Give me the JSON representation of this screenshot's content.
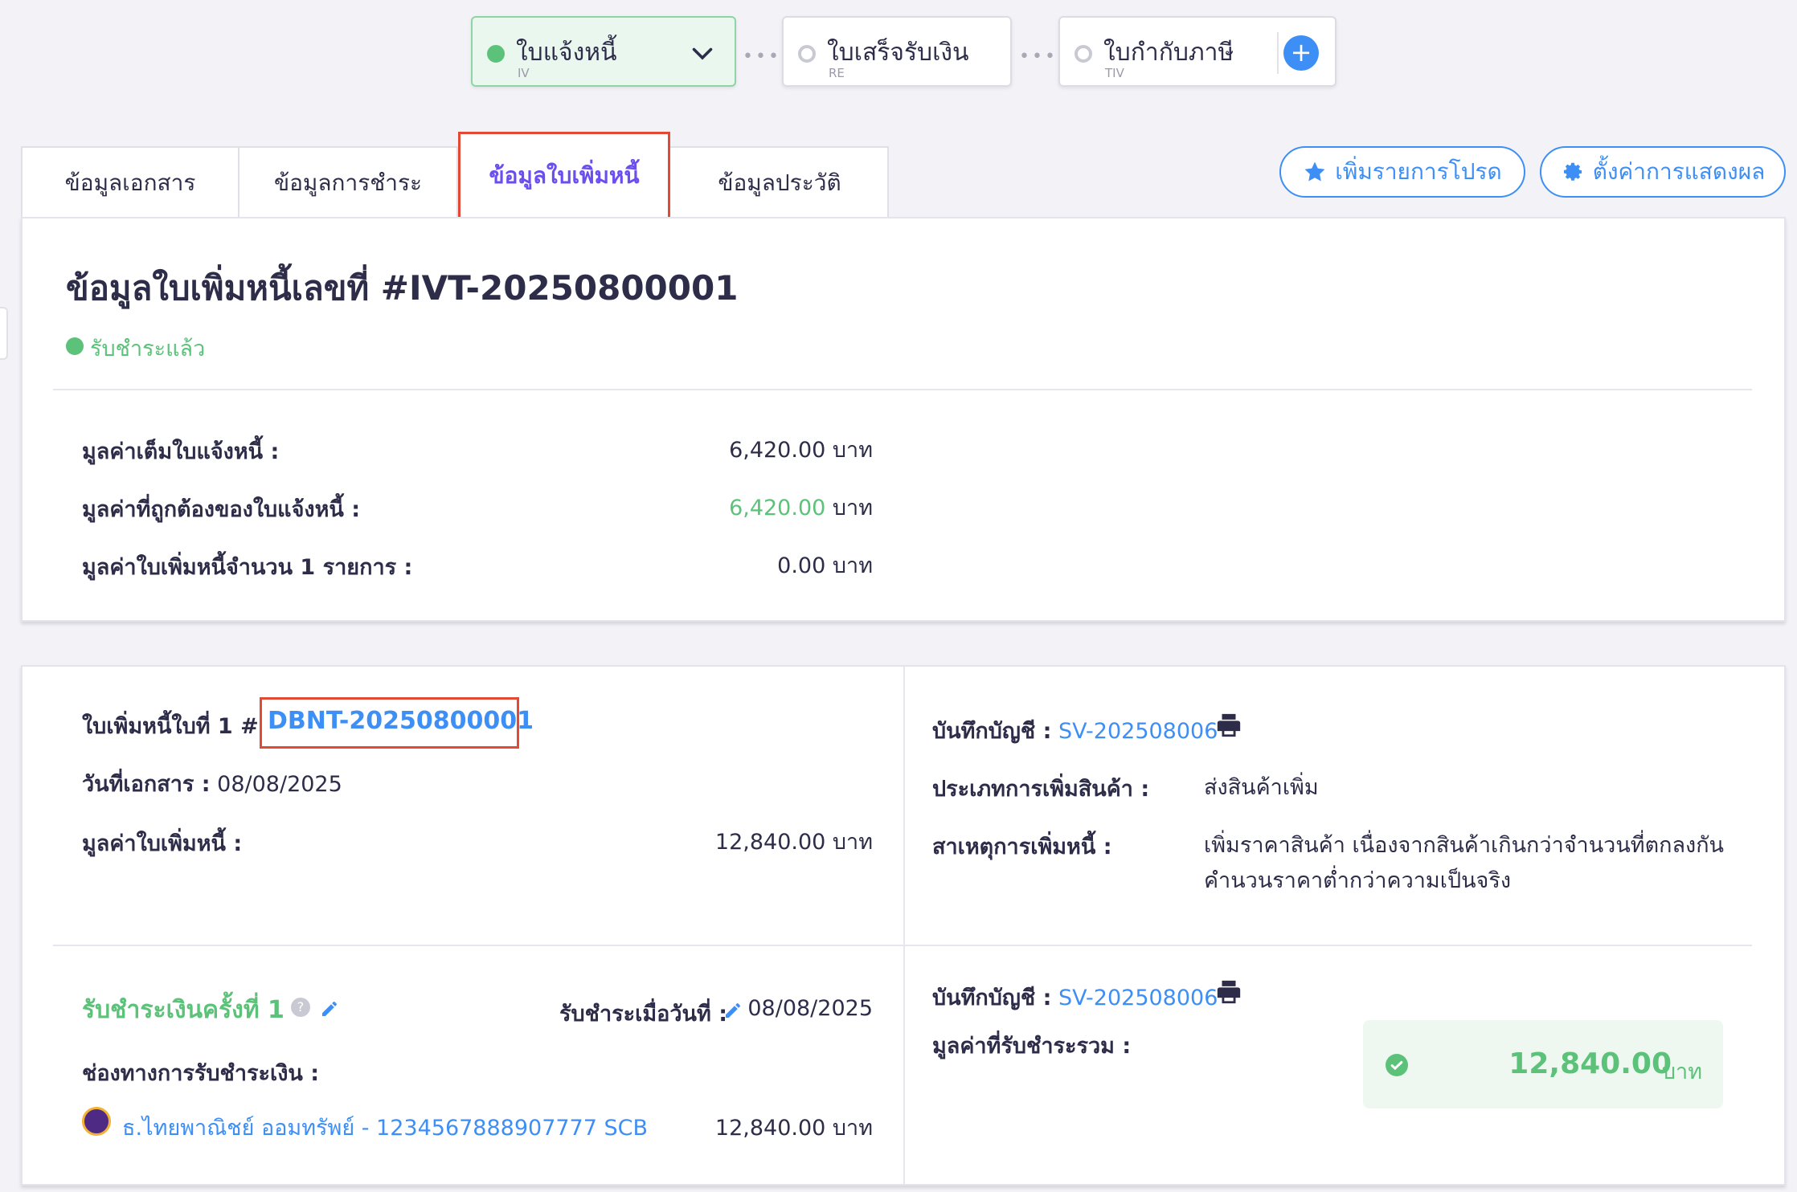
{
  "steps": [
    {
      "label": "ใบแจ้งหนี้",
      "code": "IV"
    },
    {
      "label": "ใบเสร็จรับเงิน",
      "code": "RE"
    },
    {
      "label": "ใบกำกับภาษี",
      "code": "TIV"
    }
  ],
  "tabs": [
    "ข้อมูลเอกสาร",
    "ข้อมูลการชำระ",
    "ข้อมูลใบเพิ่มหนี้",
    "ข้อมูลประวัติ"
  ],
  "actions": {
    "favorite": "เพิ่มรายการโปรด",
    "display_settings": "ตั้งค่าการแสดงผล"
  },
  "summary": {
    "title": "ข้อมูลใบเพิ่มหนี้เลขที่ #IVT-20250800001",
    "status": "รับชำระแล้ว",
    "rows": [
      {
        "label": "มูลค่าเต็มใบแจ้งหนี้ :",
        "value": "6,420.00",
        "unit": "บาท"
      },
      {
        "label": "มูลค่าที่ถูกต้องของใบแจ้งหนี้ :",
        "value": "6,420.00",
        "unit": "บาท"
      },
      {
        "label": "มูลค่าใบเพิ่มหนี้จำนวน 1 รายการ :",
        "value": "0.00",
        "unit": "บาท"
      }
    ]
  },
  "debit_note": {
    "title_prefix": "ใบเพิ่มหนี้ใบที่ 1 #",
    "number": "DBNT-20250800001",
    "date_label": "วันที่เอกสาร :",
    "date": "08/08/2025",
    "amount_label": "มูลค่าใบเพิ่มหนี้ :",
    "amount": "12,840.00 บาท",
    "journal_label": "บันทึกบัญชี :",
    "journal": "SV-202508006",
    "type_label": "ประเภทการเพิ่มสินค้า :",
    "type": "ส่งสินค้าเพิ่ม",
    "reason_label": "สาเหตุการเพิ่มหนี้ :",
    "reason_line1": "เพิ่มราคาสินค้า เนื่องจากสินค้าเกินกว่าจำนวนที่ตกลงกัน",
    "reason_line2": "คำนวนราคาต่ำกว่าความเป็นจริง"
  },
  "payment": {
    "title": "รับชำระเงินครั้งที่ 1",
    "date_label": "รับชำระเมื่อวันที่ :",
    "date": "08/08/2025",
    "channel_label": "ช่องทางการรับชำระเงิน :",
    "channel": "ธ.ไทยพาณิชย์ ออมทรัพย์ - 1234567888907777 SCB",
    "channel_amount": "12,840.00 บาท",
    "journal_label": "บันทึกบัญชี :",
    "journal": "SV-202508006",
    "total_label": "มูลค่าที่รับชำระรวม :",
    "total": "12,840.00",
    "total_unit": "บาท"
  },
  "colors": {
    "accent": "#3d8ef5",
    "success": "#5cc27a",
    "active_tab": "#6c4ef0",
    "highlight": "#e34a35"
  }
}
